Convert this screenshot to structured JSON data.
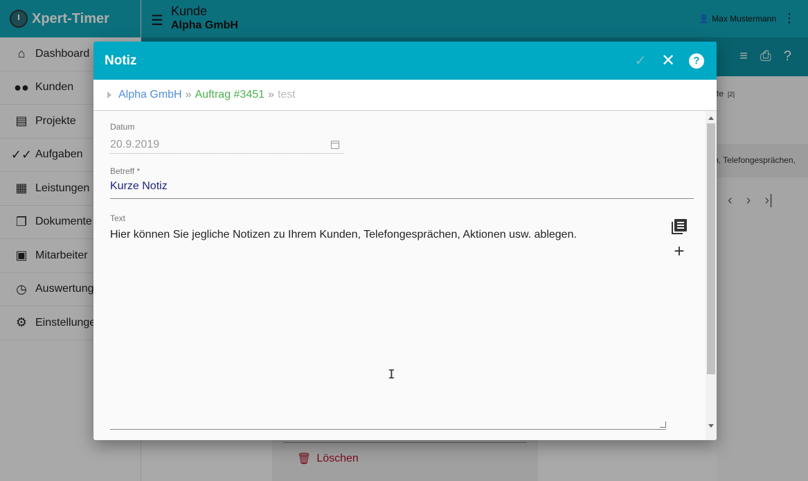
{
  "app": {
    "brand": "Xpert-Timer"
  },
  "sidebar": {
    "items": [
      {
        "label": "Dashboard",
        "icon": "home-icon"
      },
      {
        "label": "Kunden",
        "icon": "people-icon"
      },
      {
        "label": "Projekte",
        "icon": "document-icon"
      },
      {
        "label": "Aufgaben",
        "icon": "double-check-icon"
      },
      {
        "label": "Leistungen",
        "icon": "dashboard-icon"
      },
      {
        "label": "Dokumente",
        "icon": "files-icon"
      },
      {
        "label": "Mitarbeiter",
        "icon": "contact-card-icon"
      },
      {
        "label": "Auswertung",
        "icon": "clock-icon"
      },
      {
        "label": "Einstellungen",
        "icon": "gear-icon"
      }
    ]
  },
  "topbar": {
    "title": "Kunde",
    "subtitle": "Alpha GmbH",
    "user": "Max Mustermann"
  },
  "background": {
    "right_row1": "te",
    "right_row1_count": "[2]",
    "right_row2": "n, Telefongesprächen,",
    "delete_label": "Löschen"
  },
  "modal": {
    "title": "Notiz",
    "breadcrumb": {
      "customer": "Alpha GmbH",
      "separator": "»",
      "order": "Auftrag #3451",
      "current": "test"
    },
    "fields": {
      "datum_label": "Datum",
      "datum_value": "20.9.2019",
      "betreff_label": "Betreff *",
      "betreff_value": "Kurze Notiz",
      "text_label": "Text",
      "text_value": "Hier können Sie jegliche Notizen zu Ihrem Kunden, Telefongesprächen, Aktionen usw. ablegen."
    }
  },
  "colors": {
    "header_teal": "#00a9c4",
    "topbar_teal": "#13a4b7",
    "breadcrumb_blue": "#4f8fd6",
    "breadcrumb_green": "#4caf50",
    "delete_red": "#b0132a",
    "betreff_text": "#1a237e"
  }
}
